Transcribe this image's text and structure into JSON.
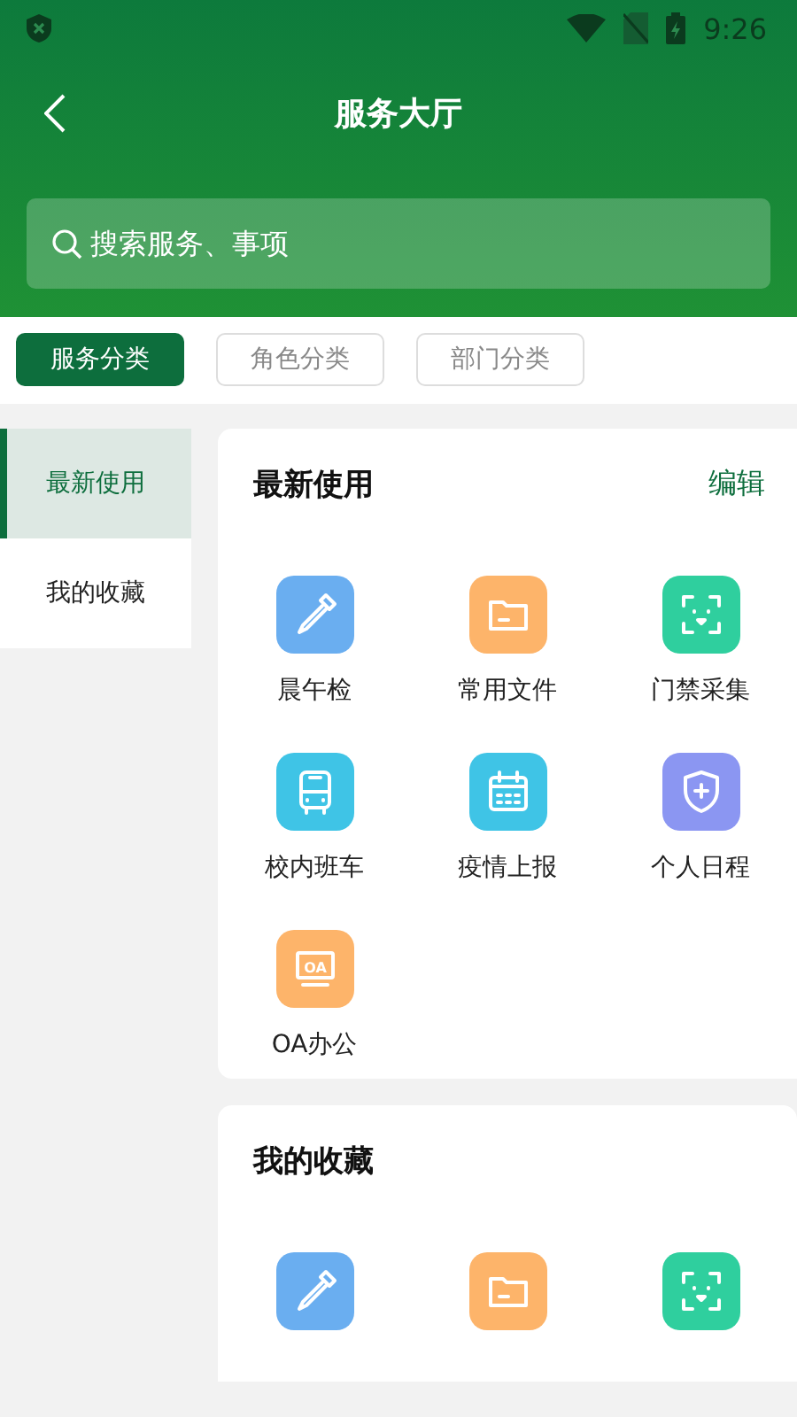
{
  "status_bar": {
    "time": "9:26"
  },
  "header": {
    "title": "服务大厅"
  },
  "search": {
    "placeholder": "搜索服务、事项"
  },
  "category_tabs": [
    {
      "label": "服务分类",
      "selected": true
    },
    {
      "label": "角色分类",
      "selected": false
    },
    {
      "label": "部门分类",
      "selected": false
    }
  ],
  "sidebar": {
    "items": [
      {
        "label": "最新使用",
        "selected": true
      },
      {
        "label": "我的收藏",
        "selected": false
      }
    ]
  },
  "recent": {
    "title": "最新使用",
    "action": "编辑",
    "items": [
      {
        "label": "晨午检",
        "color": "#6aaef0"
      },
      {
        "label": "常用文件",
        "color": "#fdb46a"
      },
      {
        "label": "门禁采集",
        "color": "#2fcf9e"
      },
      {
        "label": "校内班车",
        "color": "#3fc4e6"
      },
      {
        "label": "疫情上报",
        "color": "#3fc4e6"
      },
      {
        "label": "个人日程",
        "color": "#8b96f2"
      },
      {
        "label": "OA办公",
        "color": "#fdb46a",
        "icon_text": "OA"
      }
    ]
  },
  "favorites": {
    "title": "我的收藏",
    "items": [
      {
        "color": "#6aaef0"
      },
      {
        "color": "#fdb46a"
      },
      {
        "color": "#2fcf9e"
      }
    ]
  }
}
